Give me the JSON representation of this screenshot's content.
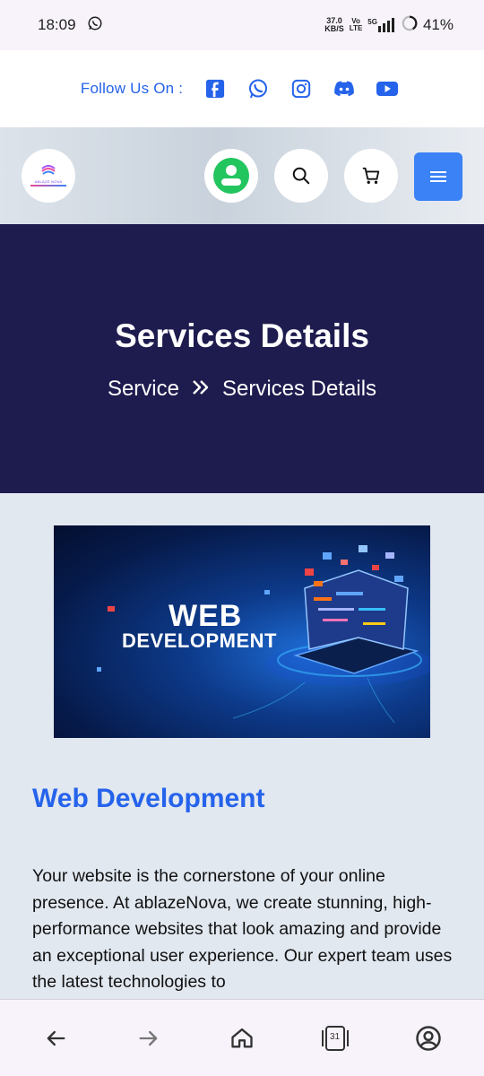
{
  "status": {
    "time": "18:09",
    "net_speed_value": "37.0",
    "net_speed_unit": "KB/S",
    "volte_top": "Vo",
    "volte_bottom": "LTE",
    "network": "5G",
    "battery": "41%"
  },
  "follow": {
    "label": "Follow Us On :",
    "socials": [
      "facebook-icon",
      "whatsapp-icon",
      "instagram-icon",
      "discord-icon",
      "youtube-icon"
    ]
  },
  "header": {
    "logo_text": "ABLAZE NOVA",
    "accent": "#3b82f6",
    "profile_color": "#22c55e"
  },
  "hero": {
    "title": "Services Details",
    "breadcrumb_home": "Service",
    "breadcrumb_separator": "»",
    "breadcrumb_current": "Services Details",
    "background": "#1e1b4e"
  },
  "banner": {
    "line1": "WEB",
    "line2": "DEVELOPMENT"
  },
  "content": {
    "title": "Web Development",
    "description": "Your website is the cornerstone of your online presence. At ablazeNova, we create stunning, high-performance websites that look amazing and provide an exceptional user experience. Our expert team uses the latest technologies to"
  },
  "bottom_nav": {
    "tab_count": "31"
  }
}
